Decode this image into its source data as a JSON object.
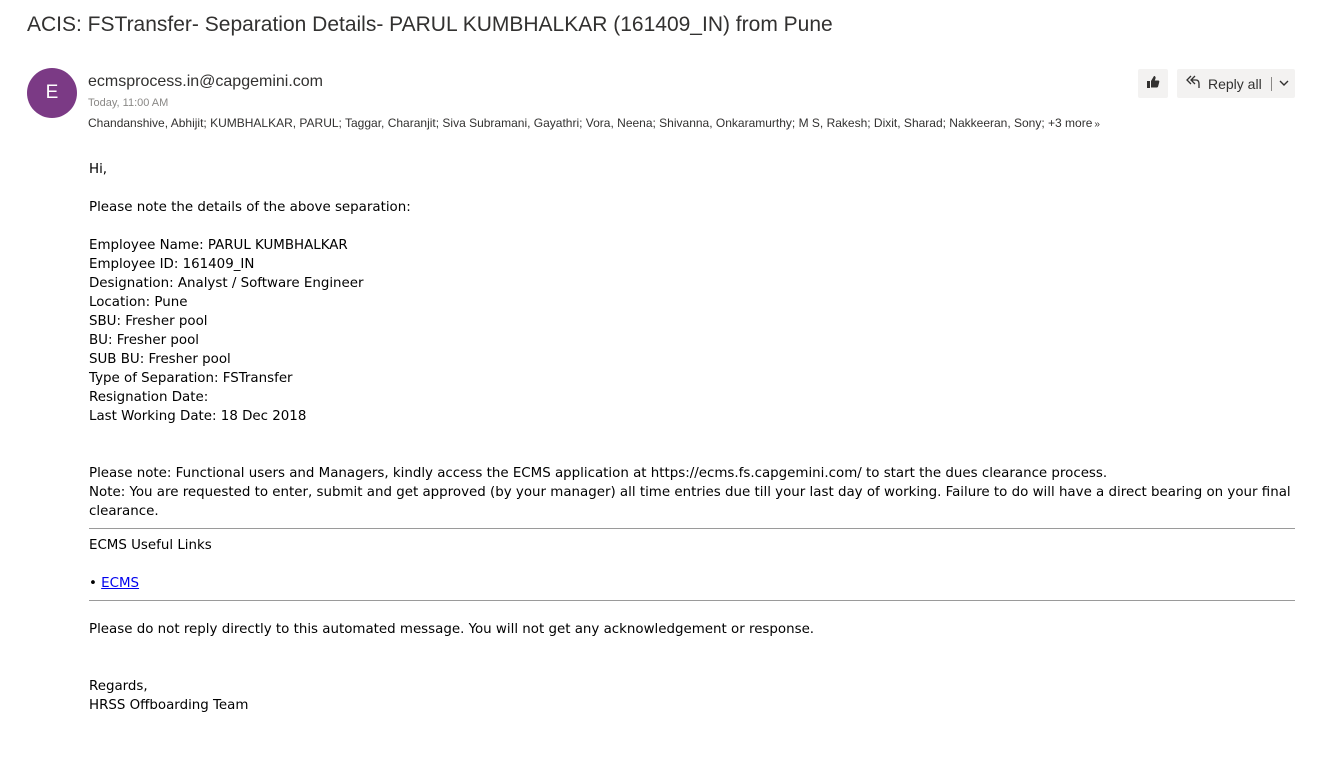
{
  "email": {
    "subject": "ACIS: FSTransfer- Separation Details- PARUL KUMBHALKAR (161409_IN) from Pune",
    "avatar_letter": "E",
    "avatar_color": "#7b3a85",
    "sender": "ecmsprocess.in@capgemini.com",
    "time": "Today, 11:00 AM",
    "recipients": "Chandanshive, Abhijit; KUMBHALKAR, PARUL; Taggar, Charanjit; Siva Subramani, Gayathri; Vora, Neena; Shivanna, Onkaramurthy; M S, Rakesh; Dixit, Sharad; Nakkeeran, Sony;",
    "more_recipients": "+3 more"
  },
  "actions": {
    "like_icon": "thumbs-up-icon",
    "reply_all_icon": "reply-all-icon",
    "reply_all_label": "Reply all",
    "dropdown_icon": "chevron-down-icon"
  },
  "body": {
    "greeting": "Hi,",
    "intro": "Please note the details of the above separation:",
    "details": {
      "employee_name": "Employee Name: PARUL KUMBHALKAR",
      "employee_id": "Employee ID: 161409_IN",
      "designation": "Designation: Analyst / Software Engineer",
      "location": "Location: Pune",
      "sbu": "SBU: Fresher pool",
      "bu": "BU: Fresher pool",
      "sub_bu": "SUB BU: Fresher pool",
      "separation_type": "Type of Separation: FSTransfer",
      "resignation_date": "Resignation Date:",
      "last_working_date": "Last Working Date: 18 Dec 2018"
    },
    "note_1": "Please note: Functional users and Managers, kindly access the ECMS application at https://ecms.fs.capgemini.com/ to start the dues clearance process.",
    "note_2": "Note: You are requested to enter, submit and get approved (by your manager) all time entries due till your last day of working. Failure to do will have a direct bearing on your final clearance.",
    "links_heading": "ECMS Useful Links",
    "bullet": "•",
    "link_label": "ECMS",
    "no_reply": "Please do not reply directly to this automated message. You will not get any acknowledgement or response.",
    "regards": "Regards,",
    "team": "HRSS Offboarding Team"
  }
}
